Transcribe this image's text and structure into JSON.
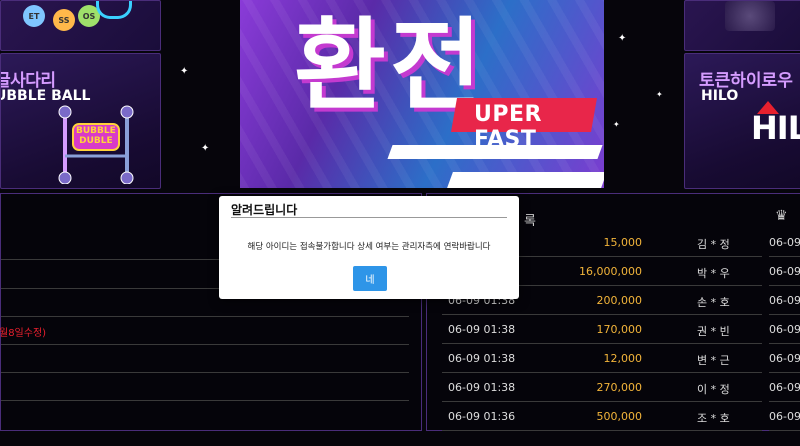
{
  "games": {
    "ladder": {
      "title": "글사다리",
      "subtitle": "UBBLE BALL",
      "art_text": "BUBBLE\nDUBLE",
      "ball_labels": [
        "ET",
        "SS",
        "OS"
      ]
    },
    "hilo": {
      "title": "토큰하이로우",
      "subtitle": "HILO",
      "logo": "HIL"
    }
  },
  "banner": {
    "headline": "환전",
    "tag": "UPER FAST"
  },
  "left_panel": {
    "notice": "월8일수정)"
  },
  "right_panel": {
    "title_fragment": "록"
  },
  "payouts": [
    {
      "time": "",
      "amount": "15,000",
      "name": "김 * 정"
    },
    {
      "time": "",
      "amount": "16,000,000",
      "name": "박 * 우"
    },
    {
      "time": "06-09 01:38",
      "amount": "200,000",
      "name": "손 * 호"
    },
    {
      "time": "06-09 01:38",
      "amount": "170,000",
      "name": "권 * 빈"
    },
    {
      "time": "06-09 01:38",
      "amount": "12,000",
      "name": "변 * 근"
    },
    {
      "time": "06-09 01:38",
      "amount": "270,000",
      "name": "이 * 정"
    },
    {
      "time": "06-09 01:36",
      "amount": "500,000",
      "name": "조 * 호"
    }
  ],
  "side_times": [
    "06-09",
    "06-09",
    "06-09",
    "06-09",
    "06-09",
    "06-09",
    "06-09"
  ],
  "modal": {
    "title": "알려드립니다",
    "message": "해당 아이디는 접속불가합니다 상세 여부는 관리자측에 연락바랍니다",
    "confirm": "네"
  },
  "colors": {
    "accent_purple": "#d59cff",
    "amount_gold": "#f2b43a",
    "notice_red": "#e8202e",
    "button_blue": "#2e95e8"
  }
}
